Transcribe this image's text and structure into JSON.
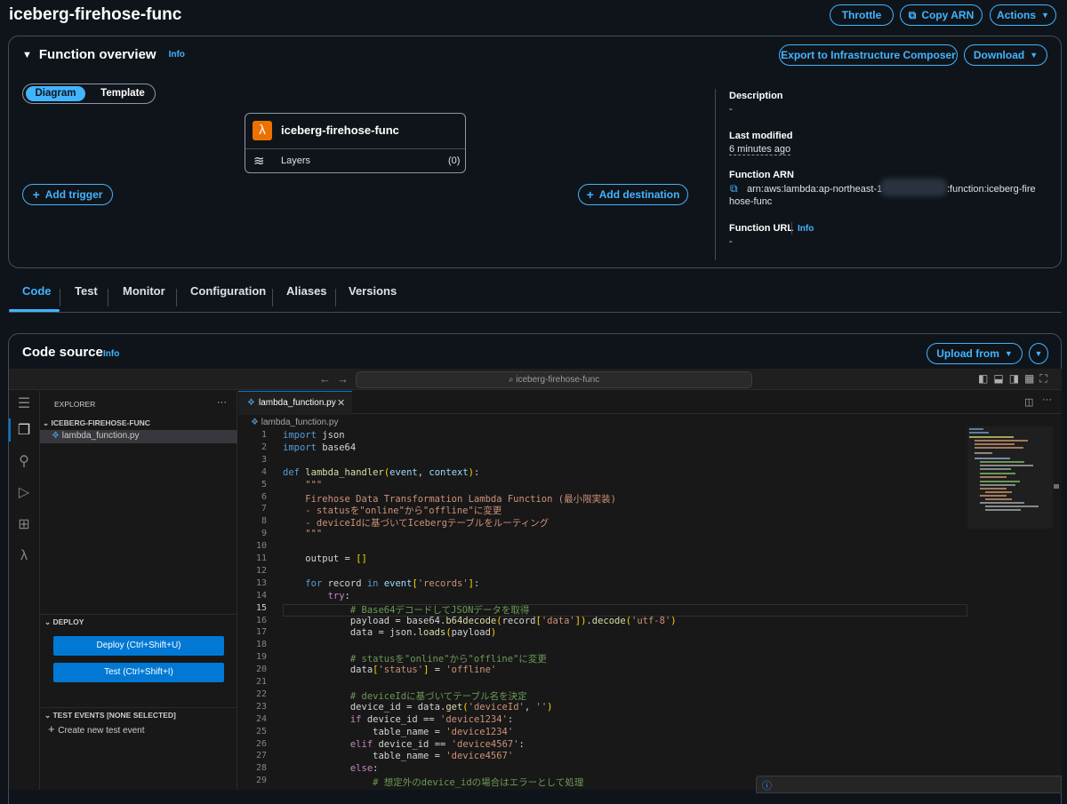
{
  "page": {
    "title": "iceberg-firehose-func"
  },
  "header_buttons": {
    "throttle": "Throttle",
    "copy_arn": "Copy ARN",
    "actions": "Actions"
  },
  "overview": {
    "title": "Function overview",
    "info": "Info",
    "export": "Export to Infrastructure Composer",
    "download": "Download",
    "toggle": {
      "diagram": "Diagram",
      "template": "Template"
    },
    "function_name": "iceberg-firehose-func",
    "layers_label": "Layers",
    "layers_count": "(0)",
    "add_trigger": "Add trigger",
    "add_destination": "Add destination",
    "description_label": "Description",
    "description_value": "-",
    "last_modified_label": "Last modified",
    "last_modified_value": "6 minutes ago",
    "arn_label": "Function ARN",
    "arn_part1": "arn:aws:lambda:ap-northeast-1",
    "arn_part2": ":function:iceberg-fire",
    "arn_part3": "hose-func",
    "url_label": "Function URL",
    "url_info": "Info",
    "url_value": "-"
  },
  "tabs": [
    "Code",
    "Test",
    "Monitor",
    "Configuration",
    "Aliases",
    "Versions"
  ],
  "code_source": {
    "title": "Code source",
    "info": "Info",
    "upload": "Upload from"
  },
  "editor": {
    "search": "iceberg-firehose-func",
    "explorer_title": "EXPLORER",
    "folder": "ICEBERG-FIREHOSE-FUNC",
    "file": "lambda_function.py",
    "tab_file": "lambda_function.py",
    "breadcrumb": "lambda_function.py",
    "deploy_title": "DEPLOY",
    "deploy_btn": "Deploy (Ctrl+Shift+U)",
    "test_btn": "Test (Ctrl+Shift+I)",
    "test_events": "TEST EVENTS [NONE SELECTED]",
    "new_test": "Create new test event"
  },
  "code_lines": [
    "import json",
    "import base64",
    "",
    "def lambda_handler(event, context):",
    "    \"\"\"",
    "    Firehose Data Transformation Lambda Function (最小限実装)",
    "    - statusを\"online\"から\"offline\"に変更",
    "    - deviceIdに基づいてIcebergテーブルをルーティング",
    "    \"\"\"",
    "",
    "    output = []",
    "",
    "    for record in event['records']:",
    "        try:",
    "            # Base64デコードしてJSONデータを取得",
    "            payload = base64.b64decode(record['data']).decode('utf-8')",
    "            data = json.loads(payload)",
    "",
    "            # statusを\"online\"から\"offline\"に変更",
    "            data['status'] = 'offline'",
    "",
    "            # deviceIdに基づいてテーブル名を決定",
    "            device_id = data.get('deviceId', '')",
    "            if device_id == 'device1234':",
    "                table_name = 'device1234'",
    "            elif device_id == 'device4567':",
    "                table_name = 'device4567'",
    "            else:",
    "                # 想定外のdevice_idの場合はエラーとして処理"
  ]
}
